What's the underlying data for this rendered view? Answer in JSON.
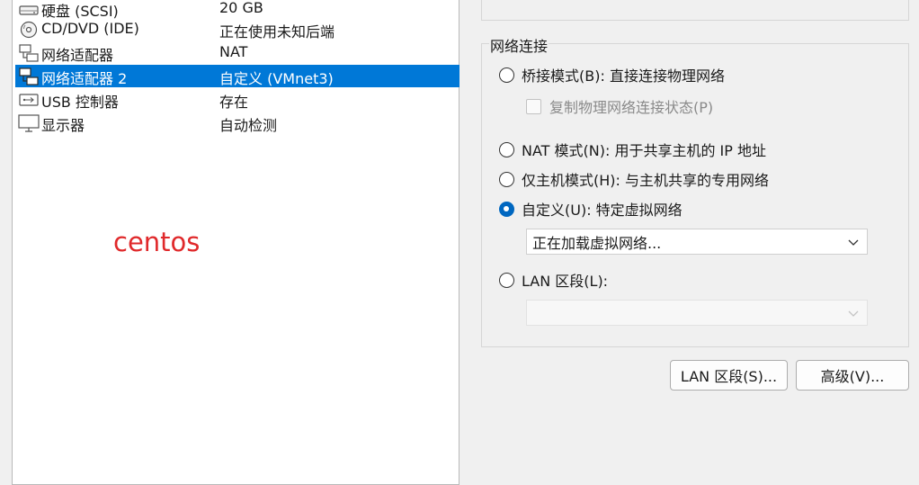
{
  "devices": [
    {
      "name": "硬盘 (SCSI)",
      "summary": "20 GB",
      "icon": "hard-disk-icon"
    },
    {
      "name": "CD/DVD (IDE)",
      "summary": "正在使用未知后端",
      "icon": "cd-dvd-icon"
    },
    {
      "name": "网络适配器",
      "summary": "NAT",
      "icon": "network-adapter-icon"
    },
    {
      "name": "网络适配器 2",
      "summary": "自定义 (VMnet3)",
      "icon": "network-adapter-icon",
      "selected": true
    },
    {
      "name": "USB 控制器",
      "summary": "存在",
      "icon": "usb-icon"
    },
    {
      "name": "显示器",
      "summary": "自动检测",
      "icon": "monitor-icon"
    }
  ],
  "annotation": "centos",
  "network": {
    "group_title": "网络连接",
    "bridged": "桥接模式(B): 直接连接物理网络",
    "replicate": "复制物理网络连接状态(P)",
    "nat": "NAT 模式(N): 用于共享主机的 IP 地址",
    "host_only": "仅主机模式(H): 与主机共享的专用网络",
    "custom": "自定义(U): 特定虚拟网络",
    "custom_select_value": "正在加载虚拟网络...",
    "lan_segment": "LAN 区段(L):",
    "lan_select_value": "",
    "selected_option": "custom"
  },
  "buttons": {
    "lan_segments": "LAN 区段(S)...",
    "advanced": "高级(V)..."
  },
  "colors": {
    "selection": "#0078d7",
    "annotation": "#e0292b",
    "radio_checked": "#0067c0"
  }
}
